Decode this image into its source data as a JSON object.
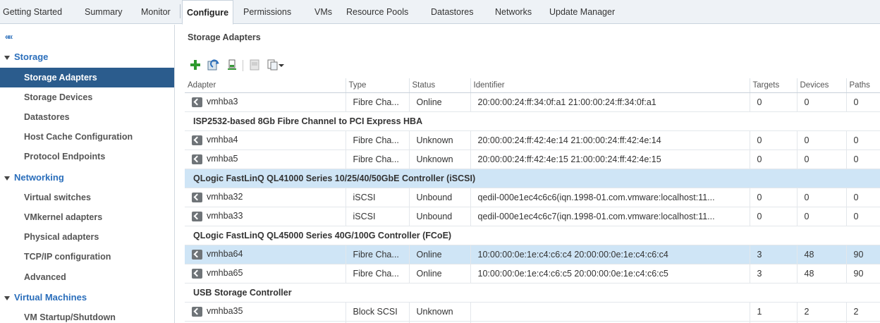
{
  "tabs": [
    {
      "label": "Getting Started"
    },
    {
      "label": "Summary"
    },
    {
      "label": "Monitor"
    },
    {
      "label": "Configure"
    },
    {
      "label": "Permissions"
    },
    {
      "label": "VMs"
    },
    {
      "label": "Resource Pools"
    },
    {
      "label": "Datastores"
    },
    {
      "label": "Networks"
    },
    {
      "label": "Update Manager"
    }
  ],
  "sidebar": {
    "collapse_glyph": "««",
    "groups": [
      {
        "label": "Storage",
        "items": [
          {
            "label": "Storage Adapters"
          },
          {
            "label": "Storage Devices"
          },
          {
            "label": "Datastores"
          },
          {
            "label": "Host Cache Configuration"
          },
          {
            "label": "Protocol Endpoints"
          }
        ]
      },
      {
        "label": "Networking",
        "items": [
          {
            "label": "Virtual switches"
          },
          {
            "label": "VMkernel adapters"
          },
          {
            "label": "Physical adapters"
          },
          {
            "label": "TCP/IP configuration"
          },
          {
            "label": "Advanced"
          }
        ]
      },
      {
        "label": "Virtual Machines",
        "items": [
          {
            "label": "VM Startup/Shutdown"
          }
        ]
      }
    ]
  },
  "main": {
    "title": "Storage Adapters",
    "toolbar_icons": [
      "add-icon",
      "rescan-icon",
      "rescan-adapter-icon",
      "remove-icon",
      "export-icon"
    ]
  },
  "table": {
    "columns": [
      "Adapter",
      "Type",
      "Status",
      "Identifier",
      "Targets",
      "Devices",
      "Paths"
    ],
    "rows": [
      {
        "kind": "adapter",
        "adapter": "vmhba3",
        "type": "Fibre Cha...",
        "status": "Online",
        "identifier": "20:00:00:24:ff:34:0f:a1 21:00:00:24:ff:34:0f:a1",
        "targets": "0",
        "devices": "0",
        "paths": "0"
      },
      {
        "kind": "group",
        "label": "ISP2532-based 8Gb Fibre Channel to PCI Express HBA"
      },
      {
        "kind": "adapter",
        "adapter": "vmhba4",
        "type": "Fibre Cha...",
        "status": "Unknown",
        "identifier": "20:00:00:24:ff:42:4e:14 21:00:00:24:ff:42:4e:14",
        "targets": "0",
        "devices": "0",
        "paths": "0"
      },
      {
        "kind": "adapter",
        "adapter": "vmhba5",
        "type": "Fibre Cha...",
        "status": "Unknown",
        "identifier": "20:00:00:24:ff:42:4e:15 21:00:00:24:ff:42:4e:15",
        "targets": "0",
        "devices": "0",
        "paths": "0"
      },
      {
        "kind": "group",
        "label": "QLogic FastLinQ QL41000 Series 10/25/40/50GbE Controller (iSCSI)",
        "highlighted": true
      },
      {
        "kind": "adapter",
        "adapter": "vmhba32",
        "type": "iSCSI",
        "status": "Unbound",
        "identifier": "qedil-000e1ec4c6c6(iqn.1998-01.com.vmware:localhost:11...",
        "targets": "0",
        "devices": "0",
        "paths": "0"
      },
      {
        "kind": "adapter",
        "adapter": "vmhba33",
        "type": "iSCSI",
        "status": "Unbound",
        "identifier": "qedil-000e1ec4c6c7(iqn.1998-01.com.vmware:localhost:11...",
        "targets": "0",
        "devices": "0",
        "paths": "0"
      },
      {
        "kind": "group",
        "label": "QLogic FastLinQ QL45000 Series 40G/100G Controller (FCoE)"
      },
      {
        "kind": "adapter",
        "adapter": "vmhba64",
        "type": "Fibre Cha...",
        "status": "Online",
        "identifier": "10:00:00:0e:1e:c4:c6:c4 20:00:00:0e:1e:c4:c6:c4",
        "targets": "3",
        "devices": "48",
        "paths": "90",
        "highlighted": true
      },
      {
        "kind": "adapter",
        "adapter": "vmhba65",
        "type": "Fibre Cha...",
        "status": "Online",
        "identifier": "10:00:00:0e:1e:c4:c6:c5 20:00:00:0e:1e:c4:c6:c5",
        "targets": "3",
        "devices": "48",
        "paths": "90"
      },
      {
        "kind": "group",
        "label": "USB Storage Controller"
      },
      {
        "kind": "adapter",
        "adapter": "vmhba35",
        "type": "Block SCSI",
        "status": "Unknown",
        "identifier": "",
        "targets": "1",
        "devices": "2",
        "paths": "2"
      }
    ]
  },
  "colors": {
    "selected_nav": "#2b5c8d",
    "highlight_row": "#cfe5f6",
    "accent": "#2a6ebb"
  }
}
